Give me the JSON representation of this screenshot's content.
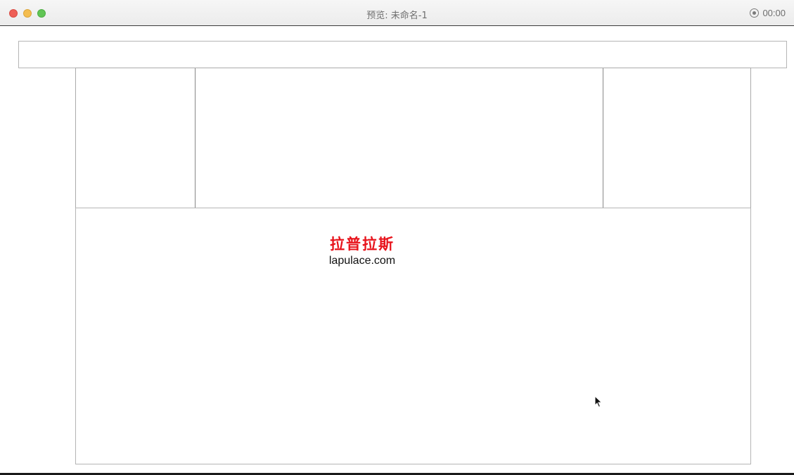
{
  "window": {
    "title": "预览: 未命名-1",
    "record_time": "00:00"
  },
  "content": {
    "watermark_cn": "拉普拉斯",
    "watermark_en": "lapulace.com"
  },
  "icons": {
    "close": "close-dot",
    "minimize": "minimize-dot",
    "maximize": "maximize-dot",
    "record": "record-icon",
    "cursor": "mouse-cursor-icon"
  },
  "colors": {
    "watermark_cn": "#e8141c",
    "close": "#ee5f57",
    "minimize": "#f4bd4f",
    "maximize": "#61c555"
  }
}
